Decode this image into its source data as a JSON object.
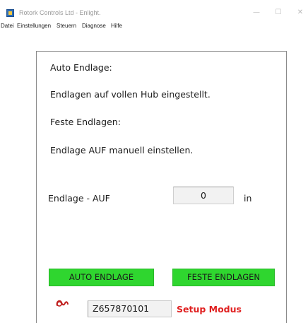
{
  "window": {
    "title": "Rotork Controls Ltd - Enlight.",
    "icon": "enlight-app-icon",
    "controls": {
      "minimize": "—",
      "maximize": "☐",
      "close": "✕"
    }
  },
  "menu": {
    "items": [
      "Datei",
      "Einstellungen",
      "Steuern",
      "Diagnose",
      "Hilfe"
    ]
  },
  "panel": {
    "auto_heading": "Auto Endlage:",
    "auto_desc": "Endlagen auf vollen Hub eingestellt.",
    "fixed_heading": "Feste Endlagen:",
    "fixed_desc": "Endlage AUF manuell einstellen.",
    "limit_label": "Endlage - AUF",
    "limit_value": "0",
    "limit_unit": "in",
    "btn_auto": "AUTO ENDLAGE",
    "btn_fixed": "FESTE ENDLAGEN",
    "serial": "Z657870101",
    "status": "Setup Modus"
  },
  "colors": {
    "button_green": "#2fd62f",
    "status_red": "#e02020",
    "logo_red": "#c0201f"
  }
}
